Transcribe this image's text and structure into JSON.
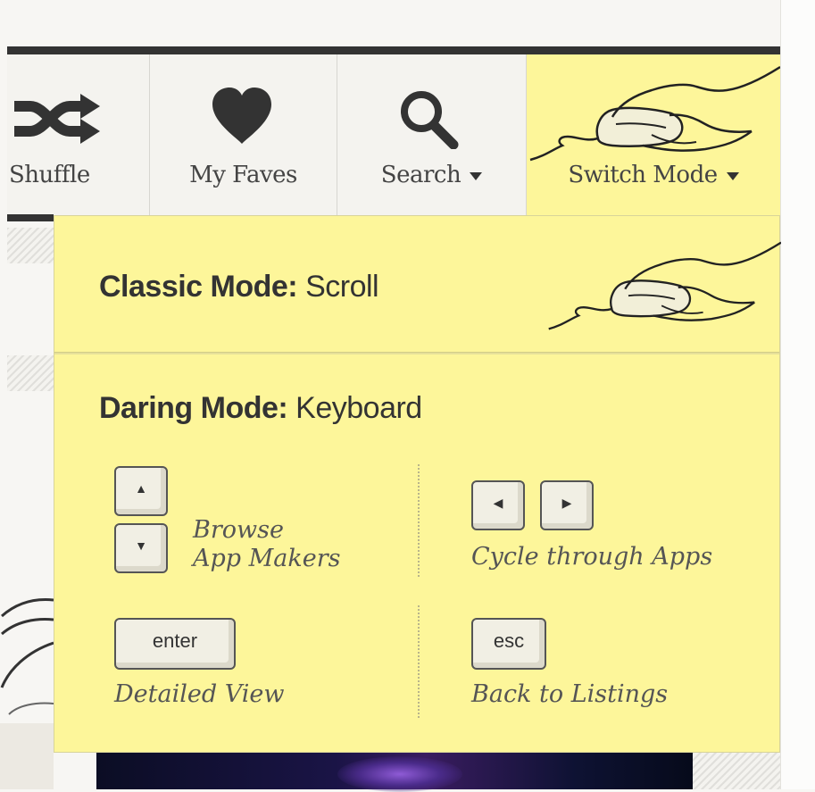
{
  "nav": {
    "shuffle_label": "Shuffle",
    "faves_label": "My Faves",
    "search_label": "Search",
    "switch_label": "Switch Mode"
  },
  "panel": {
    "classic": {
      "bold": "Classic Mode:",
      "rest": " Scroll"
    },
    "daring": {
      "bold": "Daring Mode:",
      "rest": " Keyboard"
    },
    "shortcuts": {
      "browse_line1": "Browse",
      "browse_line2": "App Makers",
      "cycle": "Cycle through Apps",
      "detailed": "Detailed View",
      "back": "Back to Listings",
      "enter_key": "enter",
      "esc_key": "esc",
      "up_key": "▲",
      "down_key": "▼",
      "left_key": "◀",
      "right_key": "▶"
    }
  },
  "colors": {
    "panel_bg": "#fdf69a",
    "nav_bg": "#f4f3ef",
    "dark_bar": "#333333"
  },
  "icons": [
    "shuffle-icon",
    "heart-icon",
    "search-icon",
    "hand-mouse-icon",
    "caret-down-icon"
  ]
}
